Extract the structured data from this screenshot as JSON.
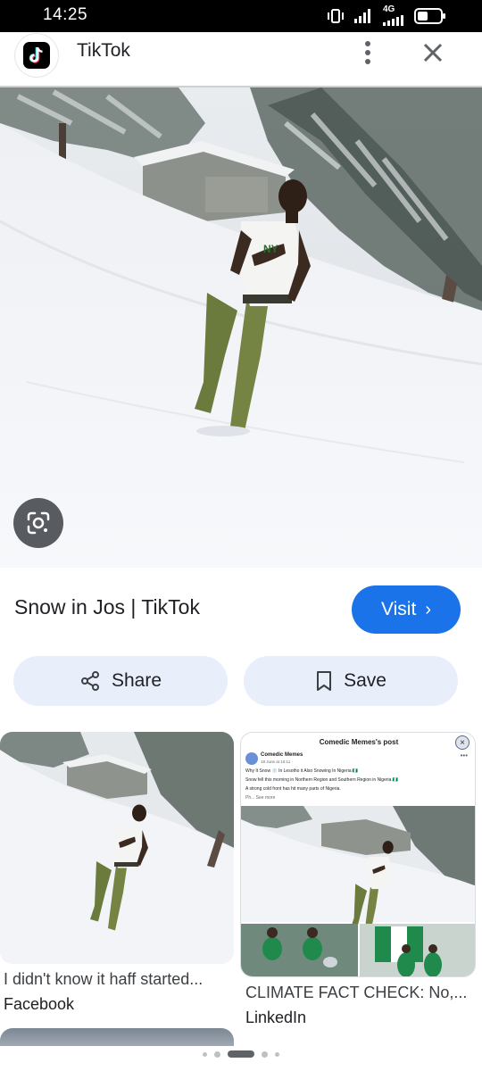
{
  "status_bar": {
    "time": "14:25",
    "network": "4G"
  },
  "header": {
    "title": "TikTok"
  },
  "result": {
    "title": "Snow in Jos | TikTok",
    "visit_label": "Visit",
    "visit_chevron": "›",
    "share_label": "Share",
    "save_label": "Save"
  },
  "related": [
    {
      "caption": "I didn't know it haff started...",
      "source": "Facebook"
    },
    {
      "caption": "CLIMATE FACT CHECK: No,...",
      "source": "LinkedIn"
    }
  ],
  "embedded_post": {
    "header": "Comedic Memes's post",
    "close": "×",
    "author": "Comedic Memes",
    "date": "18 June at 10:11 · ",
    "lines": [
      "Why It Snow ❄️ In Lesotho it Also Snowing In Nigeria 🇳🇬",
      "Snow fell this morning in Northern Region and Southern Region in Nigeria 🇳🇬",
      "A strong cold front has hit many parts of Nigeria."
    ],
    "see_more": "Ph... See more"
  },
  "icons": {
    "logo": "tiktok-logo",
    "menu": "more-vert-icon",
    "close": "close-icon",
    "lens": "google-lens-icon",
    "share": "share-icon",
    "save": "bookmark-icon"
  },
  "colors": {
    "accent": "#1a73e8",
    "chip_bg": "#e8effb",
    "status_bar": "#000000"
  },
  "pager": {
    "count": 5,
    "active_index": 2
  }
}
